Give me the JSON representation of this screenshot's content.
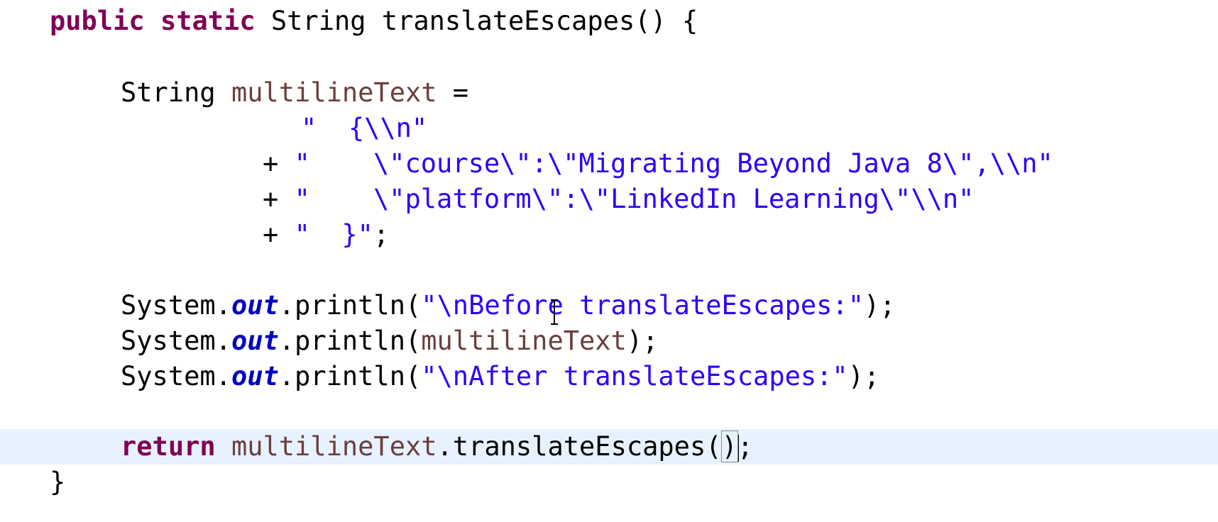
{
  "code": {
    "l1": {
      "kw1": "public",
      "kw2": "static",
      "rest": " String translateEscapes() {"
    },
    "l2": {
      "type": "String",
      "var": "multilineText",
      "rest": " ="
    },
    "l3": {
      "str": "\"  {\\\\n\""
    },
    "l4": {
      "op": "+ ",
      "str": "\"    \\\"course\\\":\\\"Migrating Beyond Java 8\\\",\\\\n\""
    },
    "l5": {
      "op": "+ ",
      "str": "\"    \\\"platform\\\":\\\"LinkedIn Learning\\\"\\\\n\""
    },
    "l6": {
      "op": "+ ",
      "str": "\"  }\"",
      "end": ";"
    },
    "l7": {
      "cls": "System.",
      "field": "out",
      "call": ".println(",
      "str": "\"\\nBefore translateEscapes:\"",
      "end": ");"
    },
    "l8": {
      "cls": "System.",
      "field": "out",
      "call": ".println(",
      "var": "multilineText",
      "end": ");"
    },
    "l9": {
      "cls": "System.",
      "field": "out",
      "call": ".println(",
      "str": "\"\\nAfter translateEscapes:\"",
      "end": ");"
    },
    "l10": {
      "kw": "return",
      "var": "multilineText",
      "call": ".translateEscapes(",
      "close": ")",
      "end": ";"
    },
    "l11": {
      "brace": "}"
    }
  },
  "colors": {
    "keyword": "#7f0055",
    "string": "#2a00ff",
    "local_variable": "#6a3e3e",
    "static_field": "#0000c0",
    "current_line_highlight": "#e8f2fe"
  },
  "icons": {
    "cursor": "text-ibeam-cursor"
  }
}
